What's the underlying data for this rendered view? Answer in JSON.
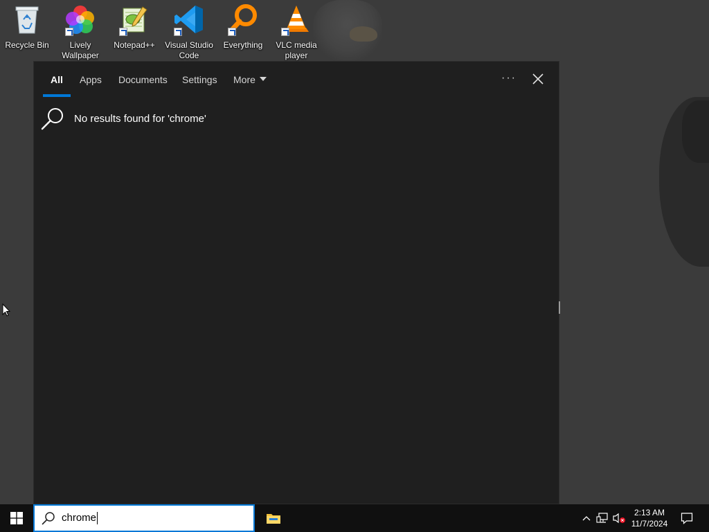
{
  "desktop": {
    "icons": [
      {
        "label_line1": "Recycle Bin",
        "label_line2": "",
        "icon": "recycle-bin-icon"
      },
      {
        "label_line1": "Lively",
        "label_line2": "Wallpaper",
        "icon": "lively-wallpaper-icon"
      },
      {
        "label_line1": "Notepad++",
        "label_line2": "",
        "icon": "notepad-plus-plus-icon"
      },
      {
        "label_line1": "Visual Studio",
        "label_line2": "Code",
        "icon": "vscode-icon"
      },
      {
        "label_line1": "Everything",
        "label_line2": "",
        "icon": "everything-search-icon"
      },
      {
        "label_line1": "VLC media",
        "label_line2": "player",
        "icon": "vlc-icon"
      }
    ]
  },
  "search_flyout": {
    "tabs": {
      "all": "All",
      "apps": "Apps",
      "documents": "Documents",
      "settings": "Settings",
      "more": "More"
    },
    "active_tab": "All",
    "options_label": "···",
    "no_results_text": "No results found for 'chrome'"
  },
  "taskbar": {
    "search_value": "chrome",
    "pinned": [
      "file-explorer-icon"
    ],
    "clock_time": "2:13 AM",
    "clock_date": "11/7/2024"
  },
  "colors": {
    "accent": "#0078d7",
    "flyout_bg": "#1f1f1f",
    "taskbar_bg": "#101010",
    "desktop_bg": "#3b3b3b"
  }
}
